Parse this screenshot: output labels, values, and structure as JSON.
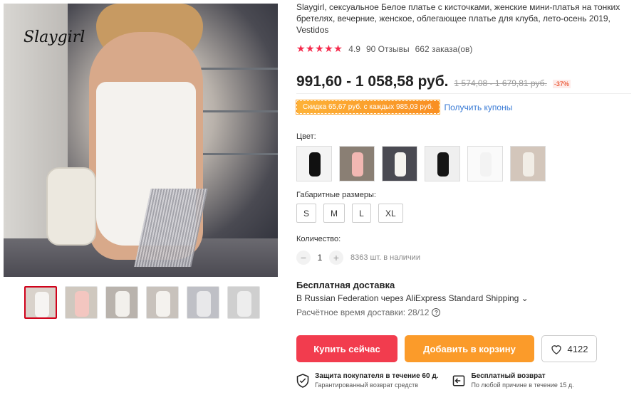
{
  "gallery": {
    "brand": "Slaygirl",
    "thumbnails": [
      {
        "color": "#f6f4f2",
        "bg": "#d9d2cb",
        "active": true
      },
      {
        "color": "#f3c6c0",
        "bg": "#cfc8bf",
        "active": false
      },
      {
        "color": "#f2f0ec",
        "bg": "#b9b3ad",
        "active": false
      },
      {
        "color": "#f4f2ee",
        "bg": "#c8c2bc",
        "active": false
      },
      {
        "color": "#e8e8ea",
        "bg": "#bfc0c6",
        "active": false
      },
      {
        "color": "#ededed",
        "bg": "#cfcfcf",
        "active": false
      }
    ]
  },
  "product": {
    "title": "Slaygirl, сексуальное Белое платье с кисточками, женские мини-платья на тонких бретелях, вечерние, женское, облегающее платье для клуба, лето-осень 2019, Vestidos",
    "stars": "★★★★★",
    "rating": "4.9",
    "reviews": "90 Отзывы",
    "orders": "662 заказа(ов)",
    "price": "991,60 - 1 058,58 руб.",
    "old_price": "1 574,08 - 1 679,81 руб.",
    "discount": "-37%",
    "coupon": "Скидка 65,67 руб. с каждых 985,03 руб.",
    "coupon_link": "Получить купоны"
  },
  "colors": {
    "label": "Цвет:",
    "swatches": [
      {
        "dress": "#111111",
        "bg": "#f4f4f4"
      },
      {
        "dress": "#f2b7b2",
        "bg": "#8a7f74"
      },
      {
        "dress": "#f5f3ef",
        "bg": "#4a4a52"
      },
      {
        "dress": "#151515",
        "bg": "#efefef"
      },
      {
        "dress": "#f3f3f3",
        "bg": "#fafafa"
      },
      {
        "dress": "#f1ede6",
        "bg": "#d3c6bb"
      }
    ]
  },
  "sizes": {
    "label": "Габаритные размеры:",
    "options": [
      "S",
      "M",
      "L",
      "XL"
    ]
  },
  "quantity": {
    "label": "Количество:",
    "minus": "−",
    "value": "1",
    "plus": "+",
    "stock": "8363 шт. в наличии"
  },
  "shipping": {
    "title": "Бесплатная доставка",
    "method": "В Russian Federation через AliExpress Standard Shipping ⌄",
    "eta": "Расчётное время доставки: 28/12",
    "help_icon": "?"
  },
  "actions": {
    "buy": "Купить сейчас",
    "cart": "Добавить в корзину",
    "wishlist_count": "4122"
  },
  "guarantees": {
    "protection_title": "Защита покупателя в течение 60 д.",
    "protection_sub": "Гарантированный возврат средств",
    "return_title": "Бесплатный возврат",
    "return_sub": "По любой причине в течение 15 д."
  }
}
